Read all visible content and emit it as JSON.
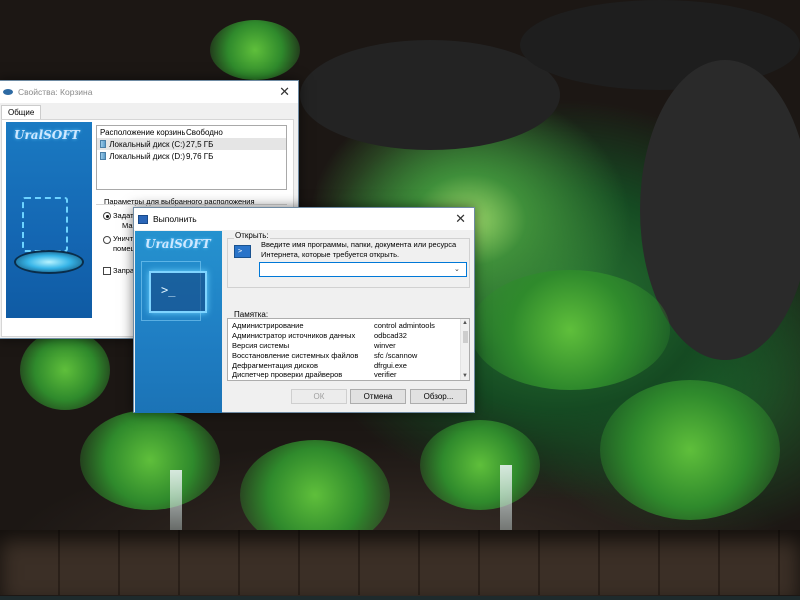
{
  "properties_window": {
    "title": "Свойства: Корзина",
    "tab": "Общие",
    "brand": "UralSOFT",
    "locations_header": {
      "col1": "Расположение корзины",
      "col2": "Свободно"
    },
    "locations": [
      {
        "name": "Локальный диск (C:)",
        "free": "27,5 ГБ",
        "selected": true
      },
      {
        "name": "Локальный диск (D:)",
        "free": "9,76 ГБ",
        "selected": false
      }
    ],
    "params_label": "Параметры для выбранного расположения",
    "radio_custom_line1": "Задат",
    "radio_custom_line2": "Ма",
    "radio_delete_line1": "Уничт",
    "radio_delete_line2": "помещ",
    "checkbox_label": "Запра"
  },
  "run_dialog": {
    "title": "Выполнить",
    "brand": "UralSOFT",
    "console_text": ">_",
    "open_label": "Открыть:",
    "prompt_icon_text": ">",
    "prompt_text": "Введите имя программы, папки, документа или ресурса Интернета, которые требуется открыть.",
    "command_value": "",
    "memo_label": "Памятка:",
    "memo_items": [
      {
        "name": "Администрирование",
        "cmd": "control admintools"
      },
      {
        "name": "Администратор источников данных",
        "cmd": "odbcad32"
      },
      {
        "name": "Версия системы",
        "cmd": "winver"
      },
      {
        "name": "Восстановление системных файлов",
        "cmd": "sfc /scannow"
      },
      {
        "name": "Дефрагментация дисков",
        "cmd": "dfrgui.exe"
      },
      {
        "name": "Диспетчер проверки драйверов",
        "cmd": "verifier"
      }
    ],
    "ok_label": "ОК",
    "cancel_label": "Отмена",
    "browse_label": "Обзор..."
  },
  "colors": {
    "banner_blue": "#1a7ac2",
    "focus_border": "#0078d7"
  }
}
